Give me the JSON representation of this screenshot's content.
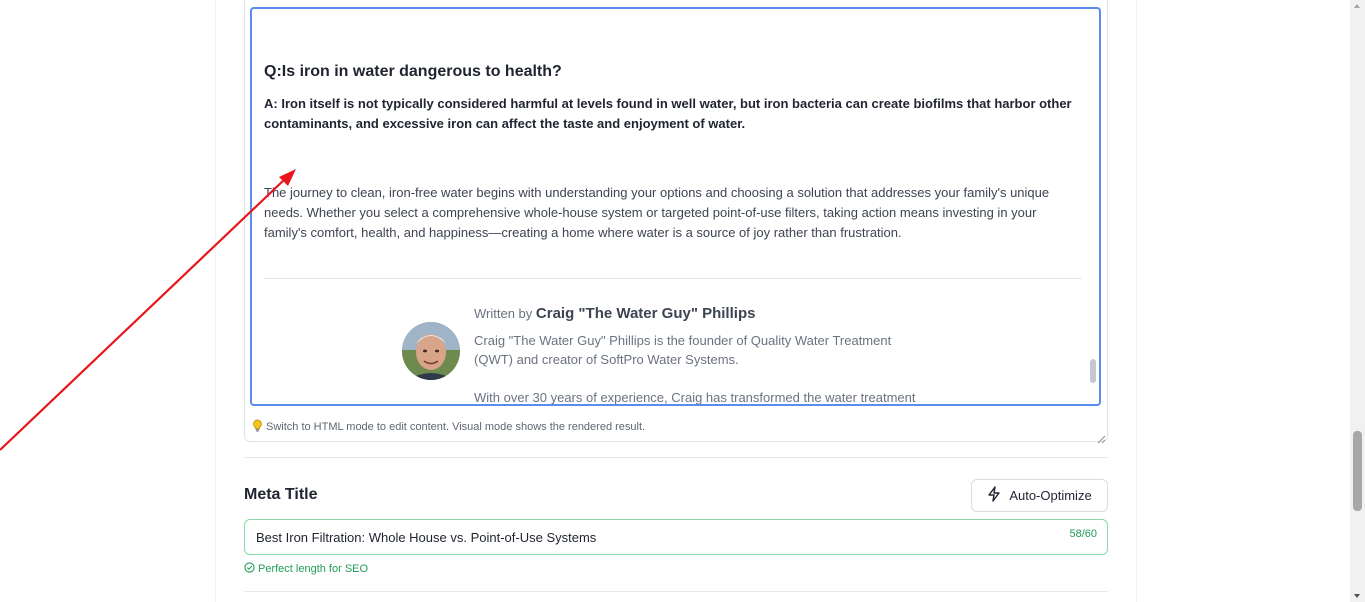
{
  "editor": {
    "question": "Q:Is iron in water dangerous to health?",
    "answer": "A: Iron itself is not typically considered harmful at levels found in well water, but iron bacteria can create biofilms that harbor other contaminants, and excessive iron can affect the taste and enjoyment of water.",
    "paragraph": "The journey to clean, iron-free water begins with understanding your options and choosing a solution that addresses your family's unique needs. Whether you select a comprehensive whole-house system or targeted point-of-use filters, taking action means investing in your family's comfort, health, and happiness—creating a home where water is a source of joy rather than frustration.",
    "author": {
      "written_by": "Written by",
      "name": "Craig \"The Water Guy\" Phillips",
      "bio1": "Craig \"The Water Guy\" Phillips is the founder of Quality Water Treatment (QWT) and creator of SoftPro Water Systems.",
      "bio2": "With over 30 years of experience, Craig has transformed the water treatment"
    },
    "hint": "Switch to HTML mode to edit content. Visual mode shows the rendered result.",
    "hint_icon": "lightbulb-icon"
  },
  "meta_title": {
    "label": "Meta Title",
    "auto_optimize_label": "Auto-Optimize",
    "auto_optimize_icon": "lightning-icon",
    "value": "Best Iron Filtration: Whole House vs. Point-of-Use Systems",
    "count": "58/60",
    "status": "Perfect length for SEO",
    "status_icon": "check-circle-icon"
  },
  "colors": {
    "accent_blue": "#5b8def",
    "success_green": "#1f9d55",
    "annotation_red": "#e8161c"
  }
}
